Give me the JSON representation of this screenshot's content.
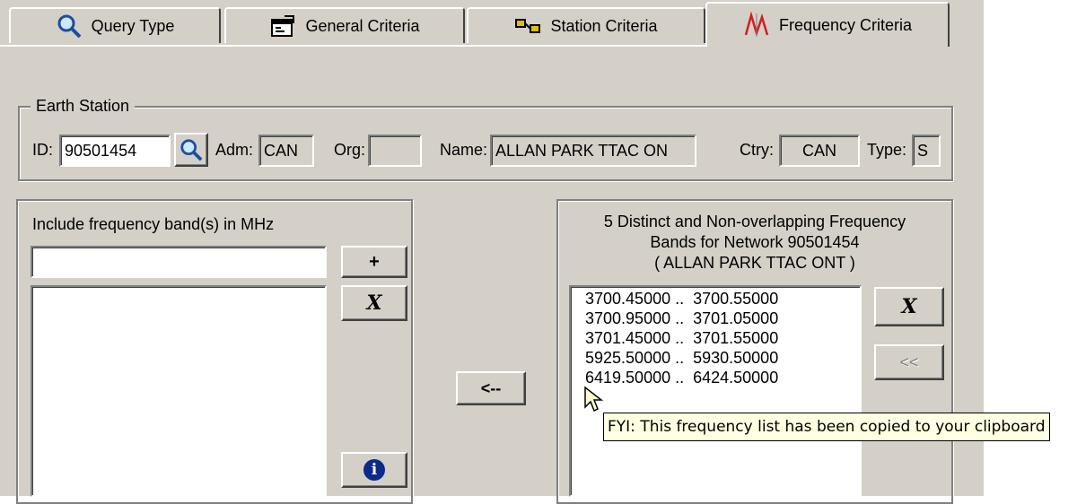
{
  "tabs": [
    {
      "label": "Query Type",
      "icon": "magnifier-icon",
      "active": false
    },
    {
      "label": "General Criteria",
      "icon": "form-icon",
      "active": false
    },
    {
      "label": "Station Criteria",
      "icon": "station-icon",
      "active": false
    },
    {
      "label": "Frequency Criteria",
      "icon": "wave-icon",
      "active": true
    }
  ],
  "earth_station": {
    "legend": "Earth Station",
    "id_label": "ID:",
    "id_value": "90501454",
    "adm_label": "Adm:",
    "adm_value": "CAN",
    "org_label": "Org:",
    "org_value": "",
    "name_label": "Name:",
    "name_value": "ALLAN PARK TTAC ON",
    "ctry_label": "Ctry:",
    "ctry_value": "CAN",
    "type_label": "Type:",
    "type_value": "S"
  },
  "include_panel": {
    "label": "Include frequency band(s)  in MHz",
    "input_value": "",
    "add_button": "+",
    "remove_button": "X",
    "info_button": "i",
    "items": []
  },
  "transfer_button": "<--",
  "network_panel": {
    "title_line1": "5 Distinct and Non-overlapping Frequency",
    "title_line2": "Bands for Network 90501454",
    "title_line3": "( ALLAN PARK TTAC ONT )",
    "items": [
      "3700.45000 ..  3700.55000",
      "3700.95000 ..  3701.05000",
      "3701.45000 ..  3701.55000",
      "5925.50000 ..  5930.50000",
      "6419.50000 ..  6424.50000"
    ],
    "remove_button": "X",
    "move_button": "<<"
  },
  "tooltip": "FYI: This frequency list has been copied to your clipboard",
  "colors": {
    "dialog_bg": "#d4d0c8",
    "tooltip_bg": "#ffffe1",
    "info_blue": "#0b2a8a"
  }
}
